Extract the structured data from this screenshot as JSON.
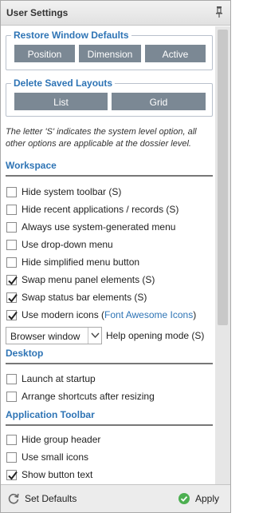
{
  "window": {
    "title": "User Settings"
  },
  "restore_group": {
    "title": "Restore Window Defaults",
    "buttons": [
      "Position",
      "Dimension",
      "Active"
    ]
  },
  "layouts_group": {
    "title": "Delete Saved Layouts",
    "buttons": [
      "List",
      "Grid"
    ]
  },
  "note": "The letter 'S' indicates the system level option, all other options are applicable at the dossier level.",
  "workspace": {
    "title": "Workspace",
    "options": [
      {
        "label": "Hide system toolbar (S)",
        "checked": false
      },
      {
        "label": "Hide recent applications / records (S)",
        "checked": false
      },
      {
        "label": "Always use system-generated menu",
        "checked": false
      },
      {
        "label": "Use drop-down menu",
        "checked": false
      },
      {
        "label": "Hide simplified menu button",
        "checked": false
      },
      {
        "label": "Swap menu panel elements (S)",
        "checked": true
      },
      {
        "label": "Swap status bar elements (S)",
        "checked": true
      },
      {
        "label": "Use modern icons (",
        "link": "Font Awesome Icons",
        "suffix": ")",
        "checked": true
      }
    ],
    "help_select": {
      "value": "Browser window",
      "label": "Help opening mode (S)"
    }
  },
  "desktop": {
    "title": "Desktop",
    "options": [
      {
        "label": "Launch at startup",
        "checked": false
      },
      {
        "label": "Arrange shortcuts after resizing",
        "checked": false
      }
    ]
  },
  "app_toolbar": {
    "title": "Application Toolbar",
    "options": [
      {
        "label": "Hide group header",
        "checked": false
      },
      {
        "label": "Use small icons",
        "checked": false
      },
      {
        "label": "Show button text",
        "checked": true
      }
    ]
  },
  "footer": {
    "set_defaults": "Set Defaults",
    "apply": "Apply"
  },
  "colors": {
    "accent": "#2e74b5",
    "button": "#7b8894",
    "apply_icon": "#4caf50"
  }
}
